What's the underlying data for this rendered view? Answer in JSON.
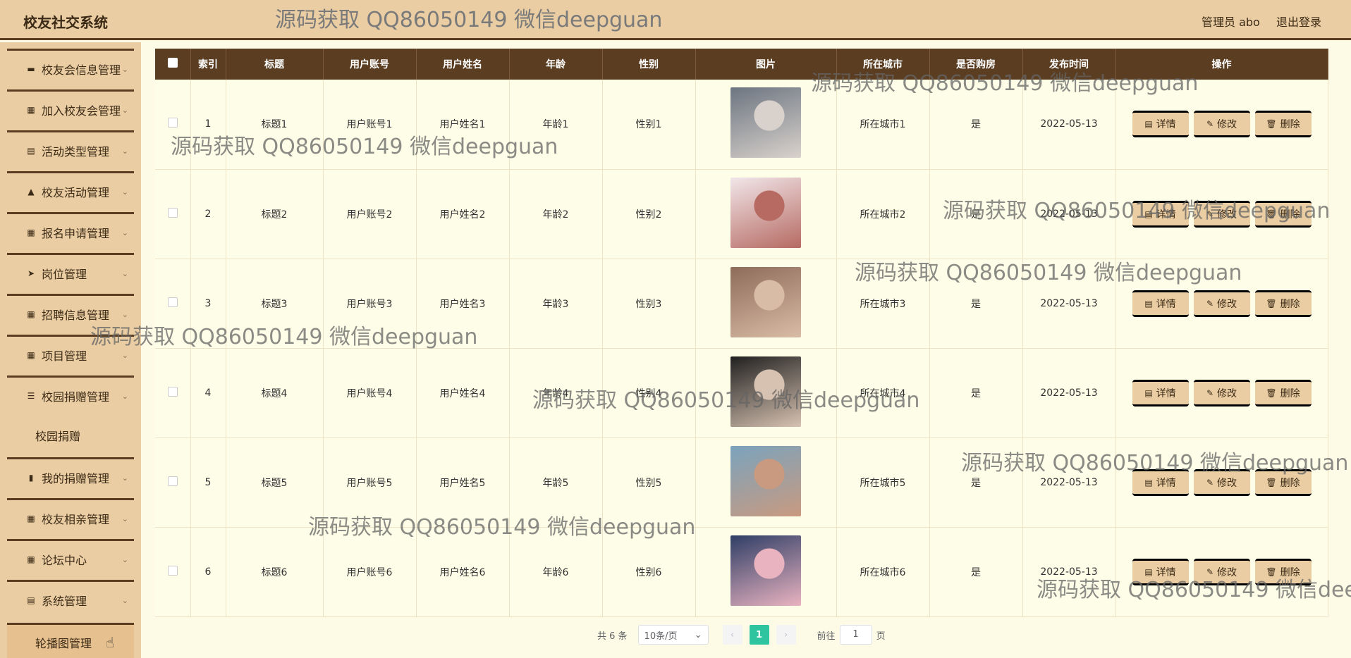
{
  "header": {
    "app_title": "校友社交系统",
    "watermark": "源码获取 QQ86050149 微信deepguan",
    "admin": "管理员 abo",
    "logout": "退出登录"
  },
  "sidebar": {
    "items": [
      {
        "label": "校友会信息管理",
        "icon": "briefcase-icon"
      },
      {
        "label": "加入校友会管理",
        "icon": "grid-icon"
      },
      {
        "label": "活动类型管理",
        "icon": "clipboard-icon"
      },
      {
        "label": "校友活动管理",
        "icon": "thumb-icon"
      },
      {
        "label": "报名申请管理",
        "icon": "grid-icon"
      },
      {
        "label": "岗位管理",
        "icon": "send-icon"
      },
      {
        "label": "招聘信息管理",
        "icon": "grid-icon"
      },
      {
        "label": "项目管理",
        "icon": "grid-icon"
      },
      {
        "label": "校园捐赠管理",
        "icon": "list-icon"
      },
      {
        "label": "我的捐赠管理",
        "icon": "bar-chart-icon"
      },
      {
        "label": "校友相亲管理",
        "icon": "grid-icon"
      },
      {
        "label": "论坛中心",
        "icon": "grid-icon"
      },
      {
        "label": "系统管理",
        "icon": "clipboard-icon"
      }
    ],
    "sub_items": [
      "校园捐赠",
      "轮播图管理"
    ]
  },
  "table": {
    "headers": [
      "索引",
      "标题",
      "用户账号",
      "用户姓名",
      "年龄",
      "性别",
      "图片",
      "所在城市",
      "是否购房",
      "发布时间",
      "操作"
    ],
    "rows": [
      {
        "index": "1",
        "title": "标题1",
        "account": "用户账号1",
        "name": "用户姓名1",
        "age": "年龄1",
        "gender": "性别1",
        "city": "所在城市1",
        "house": "是",
        "date": "2022-05-13"
      },
      {
        "index": "2",
        "title": "标题2",
        "account": "用户账号2",
        "name": "用户姓名2",
        "age": "年龄2",
        "gender": "性别2",
        "city": "所在城市2",
        "house": "是",
        "date": "2022-05-13"
      },
      {
        "index": "3",
        "title": "标题3",
        "account": "用户账号3",
        "name": "用户姓名3",
        "age": "年龄3",
        "gender": "性别3",
        "city": "所在城市3",
        "house": "是",
        "date": "2022-05-13"
      },
      {
        "index": "4",
        "title": "标题4",
        "account": "用户账号4",
        "name": "用户姓名4",
        "age": "年龄4",
        "gender": "性别4",
        "city": "所在城市4",
        "house": "是",
        "date": "2022-05-13"
      },
      {
        "index": "5",
        "title": "标题5",
        "account": "用户账号5",
        "name": "用户姓名5",
        "age": "年龄5",
        "gender": "性别5",
        "city": "所在城市5",
        "house": "是",
        "date": "2022-05-13"
      },
      {
        "index": "6",
        "title": "标题6",
        "account": "用户账号6",
        "name": "用户姓名6",
        "age": "年龄6",
        "gender": "性别6",
        "city": "所在城市6",
        "house": "是",
        "date": "2022-05-13"
      }
    ],
    "actions": {
      "detail": "详情",
      "edit": "修改",
      "delete": "删除"
    }
  },
  "pagination": {
    "total": "共 6 条",
    "page_size": "10条/页",
    "current_page": "1",
    "goto_prefix": "前往",
    "goto_value": "1",
    "goto_suffix": "页"
  },
  "colors": {
    "header_bg": "#eacda3",
    "table_header_bg": "#5b3e22",
    "page_bg": "#fdfbe6",
    "active_page": "#2ec4a0"
  }
}
